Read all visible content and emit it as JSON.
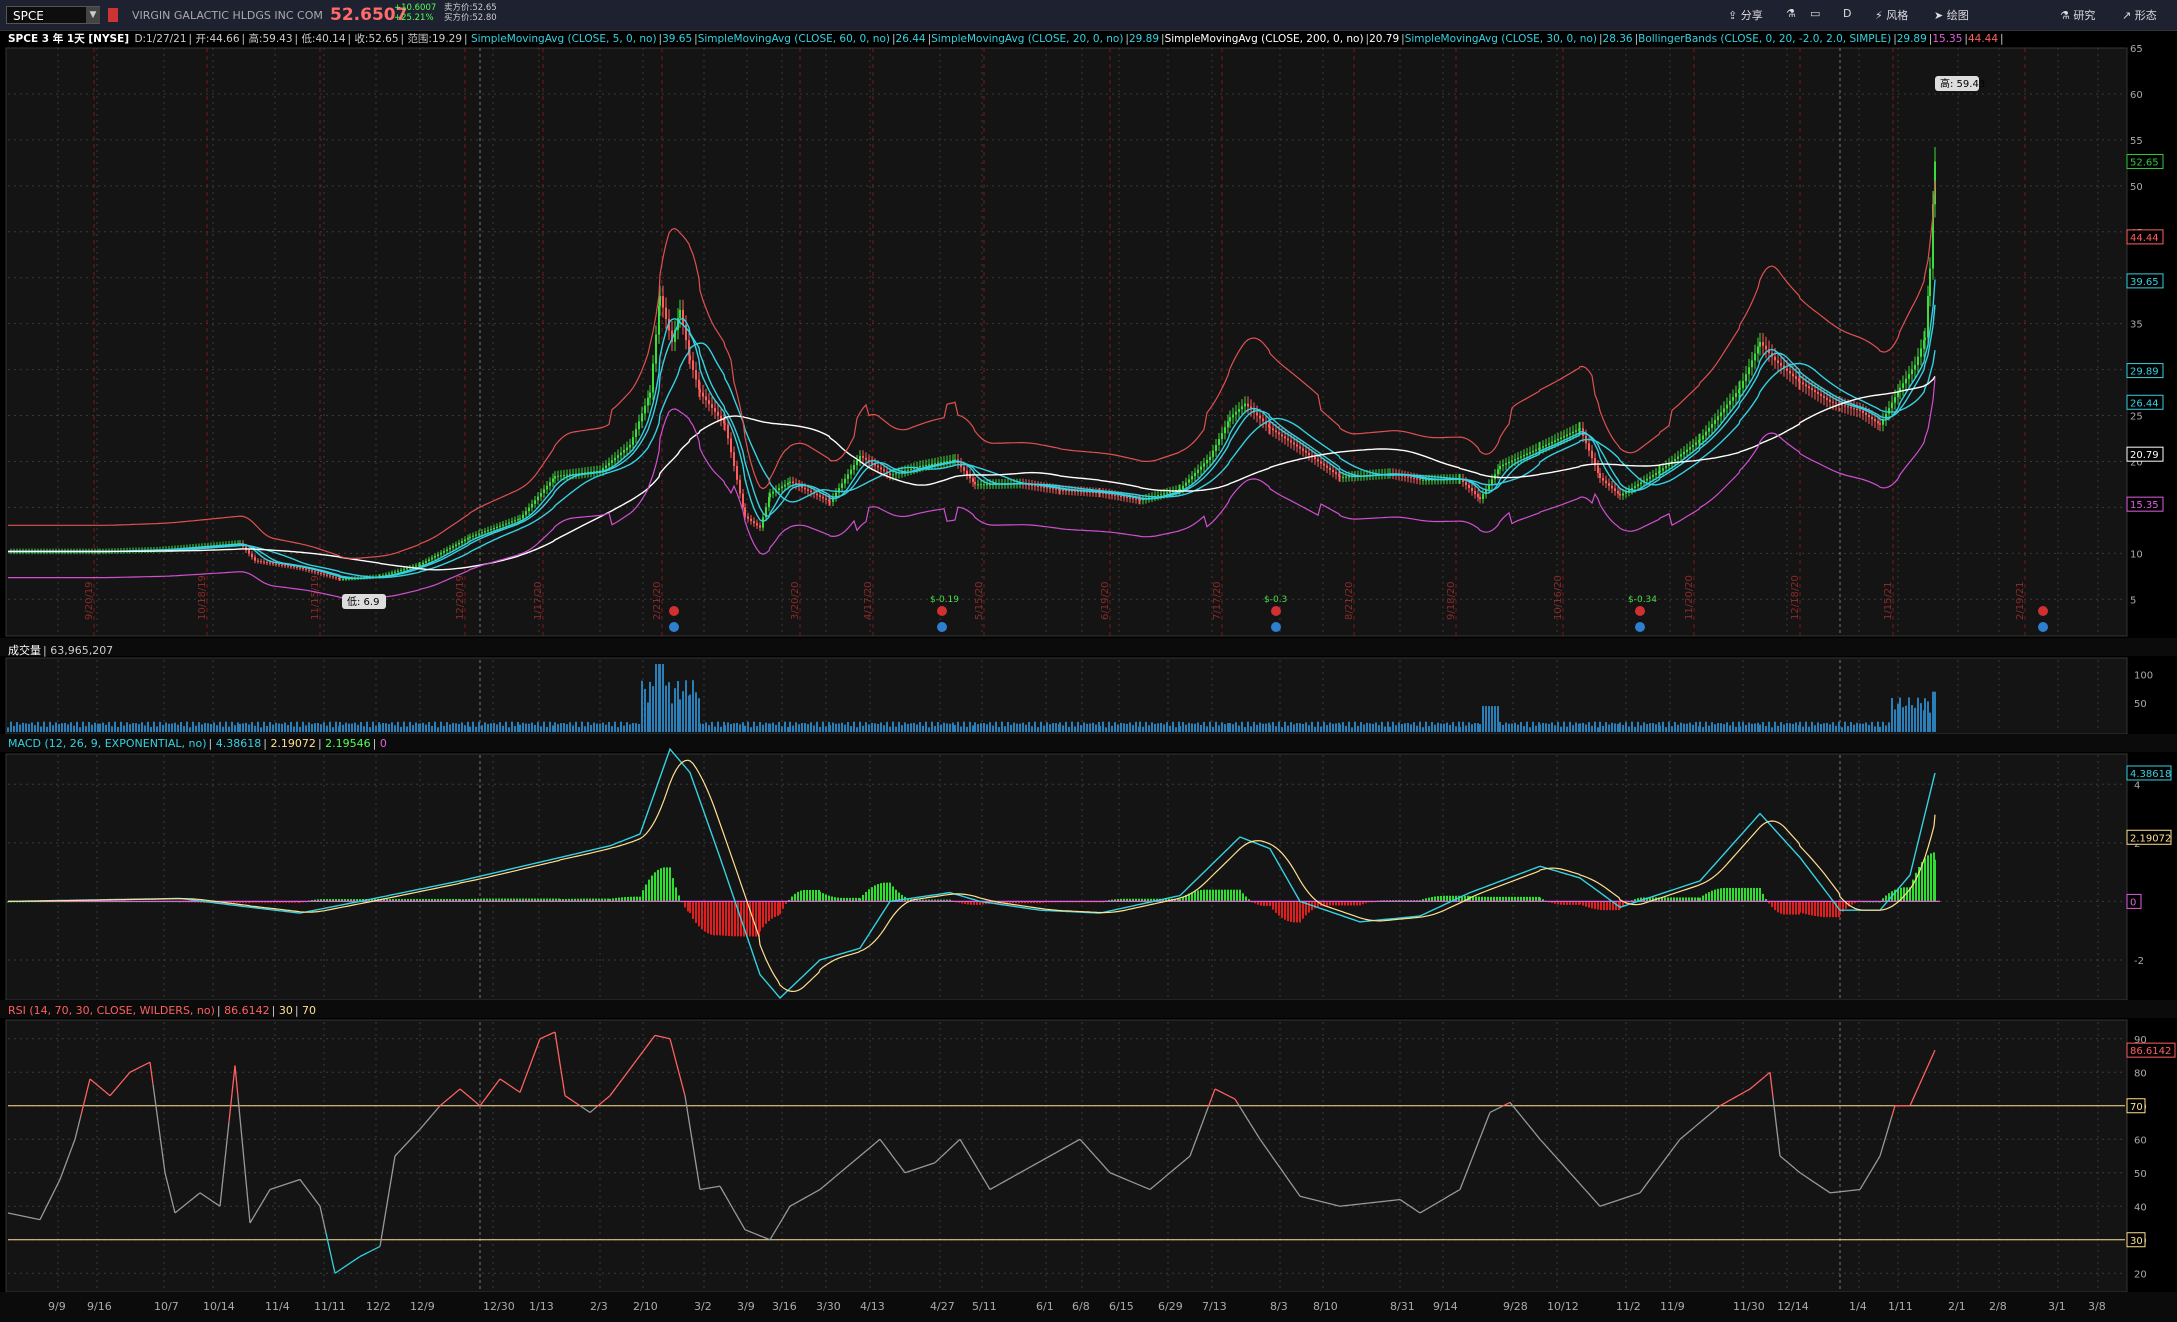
{
  "toolbar": {
    "symbol": "SPCE",
    "company": "VIRGIN GALACTIC HLDGS INC COM",
    "last": "52.6507",
    "change_abs": "+10.6007",
    "change_pct": "+25.21%",
    "ask": "卖方价:52.65",
    "bid": "买方价:52.80",
    "share": "分享",
    "period": "D",
    "style": "风格",
    "drawings": "绘图",
    "studies": "研究",
    "patterns": "形态"
  },
  "price_panel": {
    "title": "SPCE 3 年 1天 [NYSE]",
    "date": "D:1/27/21",
    "open": "开:44.66",
    "high": "高:59.43",
    "low": "低:40.14",
    "close": "收:52.65",
    "range": "范围:19.29",
    "studies": [
      {
        "label": "SimpleMovingAvg (CLOSE, 5, 0, no)",
        "value": "39.65",
        "color": "#35d1e0"
      },
      {
        "label": "SimpleMovingAvg (CLOSE, 60, 0, no)",
        "value": "26.44",
        "color": "#35d1e0"
      },
      {
        "label": "SimpleMovingAvg (CLOSE, 20, 0, no)",
        "value": "29.89",
        "color": "#35d1e0"
      },
      {
        "label": "SimpleMovingAvg (CLOSE, 200, 0, no)",
        "value": "20.79",
        "color": "#ffffff"
      },
      {
        "label": "SimpleMovingAvg (CLOSE, 30, 0, no)",
        "value": "28.36",
        "color": "#35d1e0"
      },
      {
        "label": "BollingerBands (CLOSE, 0, 20, -2.0, 2.0, SIMPLE)",
        "value": "29.89",
        "color": "#35d1e0"
      },
      {
        "label": "",
        "value": "15.35",
        "color": "#e060e0"
      },
      {
        "label": "",
        "value": "44.44",
        "color": "#ff6060"
      }
    ],
    "high_bubble": "高: 59.43",
    "low_bubble": "低: 6.9",
    "axis_ticks": [
      "65",
      "60",
      "55",
      "50",
      "45",
      "40",
      "35",
      "30",
      "25",
      "20",
      "15",
      "10",
      "5"
    ],
    "right_labels": [
      {
        "text": "52.65",
        "color": "#2ecc40"
      },
      {
        "text": "44.44",
        "color": "#ff6060"
      },
      {
        "text": "39.65",
        "color": "#35d1e0"
      },
      {
        "text": "29.89",
        "color": "#35d1e0"
      },
      {
        "text": "26.44",
        "color": "#35d1e0"
      },
      {
        "text": "20.79",
        "color": "#ffffff"
      },
      {
        "text": "15.35",
        "color": "#e060e0"
      }
    ],
    "earnings_notes": [
      "$-0.19",
      "$-0.3",
      "$-0.34"
    ],
    "vertical_dates": [
      "9/20/19",
      "10/18/19",
      "11/15/19",
      "12/20/19",
      "1/17/20",
      "2/21/20",
      "3/20/20",
      "4/17/20",
      "5/15/20",
      "6/19/20",
      "7/17/20",
      "8/21/20",
      "9/18/20",
      "10/16/20",
      "11/20/20",
      "12/18/20",
      "1/15/21",
      "2/19/21"
    ]
  },
  "volume_panel": {
    "title": "成交量",
    "value": "63,965,207",
    "axis_ticks": [
      "100",
      "50"
    ]
  },
  "macd_panel": {
    "title": "MACD (12, 26, 9, EXPONENTIAL, no)",
    "values": [
      "4.38618",
      "2.19072",
      "2.19546",
      "0"
    ],
    "axis_ticks": [
      "4",
      "2",
      "0",
      "-2"
    ],
    "right_labels": [
      {
        "text": "4.38618",
        "color": "#35d1e0"
      },
      {
        "text": "2.19072",
        "color": "#ffe090"
      },
      {
        "text": "0",
        "color": "#e060e0"
      }
    ]
  },
  "rsi_panel": {
    "title": "RSI (14, 70, 30, CLOSE, WILDERS, no)",
    "values": [
      "86.6142",
      "30",
      "70"
    ],
    "axis_ticks": [
      "90",
      "80",
      "70",
      "60",
      "50",
      "40",
      "30",
      "20"
    ],
    "right_labels": [
      {
        "text": "86.6142",
        "color": "#ff6060"
      },
      {
        "text": "70",
        "color": "#ffe090"
      },
      {
        "text": "30",
        "color": "#ffe090"
      }
    ]
  },
  "chart_data": {
    "type": "line",
    "x_ticks": [
      "9/9",
      "9/16",
      "10/7",
      "10/14",
      "11/4",
      "11/11",
      "12/2",
      "12/9",
      "12/30",
      "1/13",
      "2/3",
      "2/10",
      "3/2",
      "3/9",
      "3/16",
      "3/30",
      "4/13",
      "4/27",
      "5/11",
      "6/1",
      "6/8",
      "6/15",
      "6/29",
      "7/13",
      "8/3",
      "8/10",
      "8/31",
      "9/14",
      "9/28",
      "10/12",
      "11/2",
      "11/9",
      "11/30",
      "12/14",
      "1/4",
      "1/11",
      "2/1",
      "2/8",
      "3/1",
      "3/8"
    ],
    "ylim": [
      0,
      65
    ],
    "series": [
      {
        "name": "SimpleMovingAvg (CLOSE, 200, 0, no)",
        "values": [
          10.6,
          10.5,
          10.4,
          10.3,
          10.2,
          10.2,
          10.3,
          10.5,
          11,
          11.7,
          12.4,
          13.2,
          14.1,
          14.7,
          15.1,
          15.4,
          15.7,
          16,
          16.2,
          16.3,
          16.3,
          16.6,
          17.5,
          18.4,
          19.2,
          19.8,
          20.8
        ]
      },
      {
        "name": "SimpleMovingAvg (CLOSE, 5, 0, no)",
        "values": [
          10.2,
          10.2,
          10.3,
          11,
          9.2,
          7.2,
          8.6,
          11.5,
          17.5,
          19.5,
          27,
          36.5,
          28,
          16.5,
          12.5,
          19.4,
          18.3,
          17.4,
          16,
          16.5,
          27,
          22,
          18.4,
          16,
          16,
          19,
          22.5,
          17.5,
          20,
          24.5,
          29.5,
          32.5,
          26,
          24.6,
          33,
          39.65
        ]
      }
    ]
  }
}
